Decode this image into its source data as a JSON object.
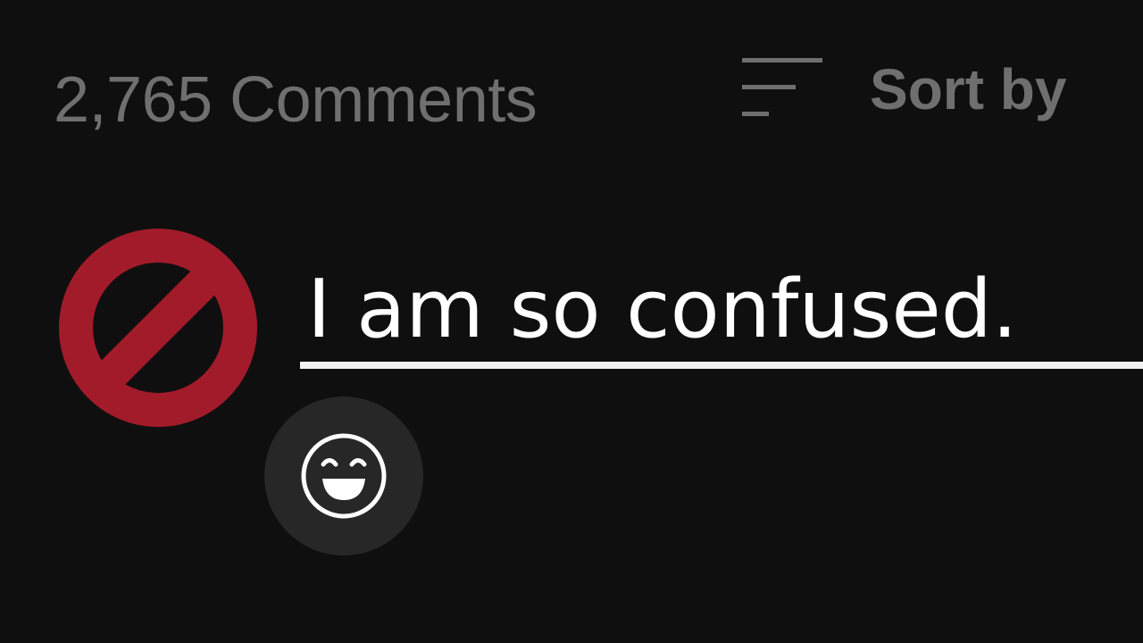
{
  "comments_header": {
    "count_label": "2,765 Comments",
    "sort_label": "Sort by",
    "sort_icon": "sort-lines-icon"
  },
  "comment_box": {
    "avatar_icon": "no-entry-icon",
    "value": "I am so confused.",
    "emoji_icon": "smiley-face-icon"
  },
  "colors": {
    "background": "#0f0f0f",
    "muted_text": "#6f6f6f",
    "input_text": "#ffffff",
    "underline": "#f1f1f1",
    "avatar_red": "#a21b2a",
    "emoji_button_bg": "#272727"
  }
}
